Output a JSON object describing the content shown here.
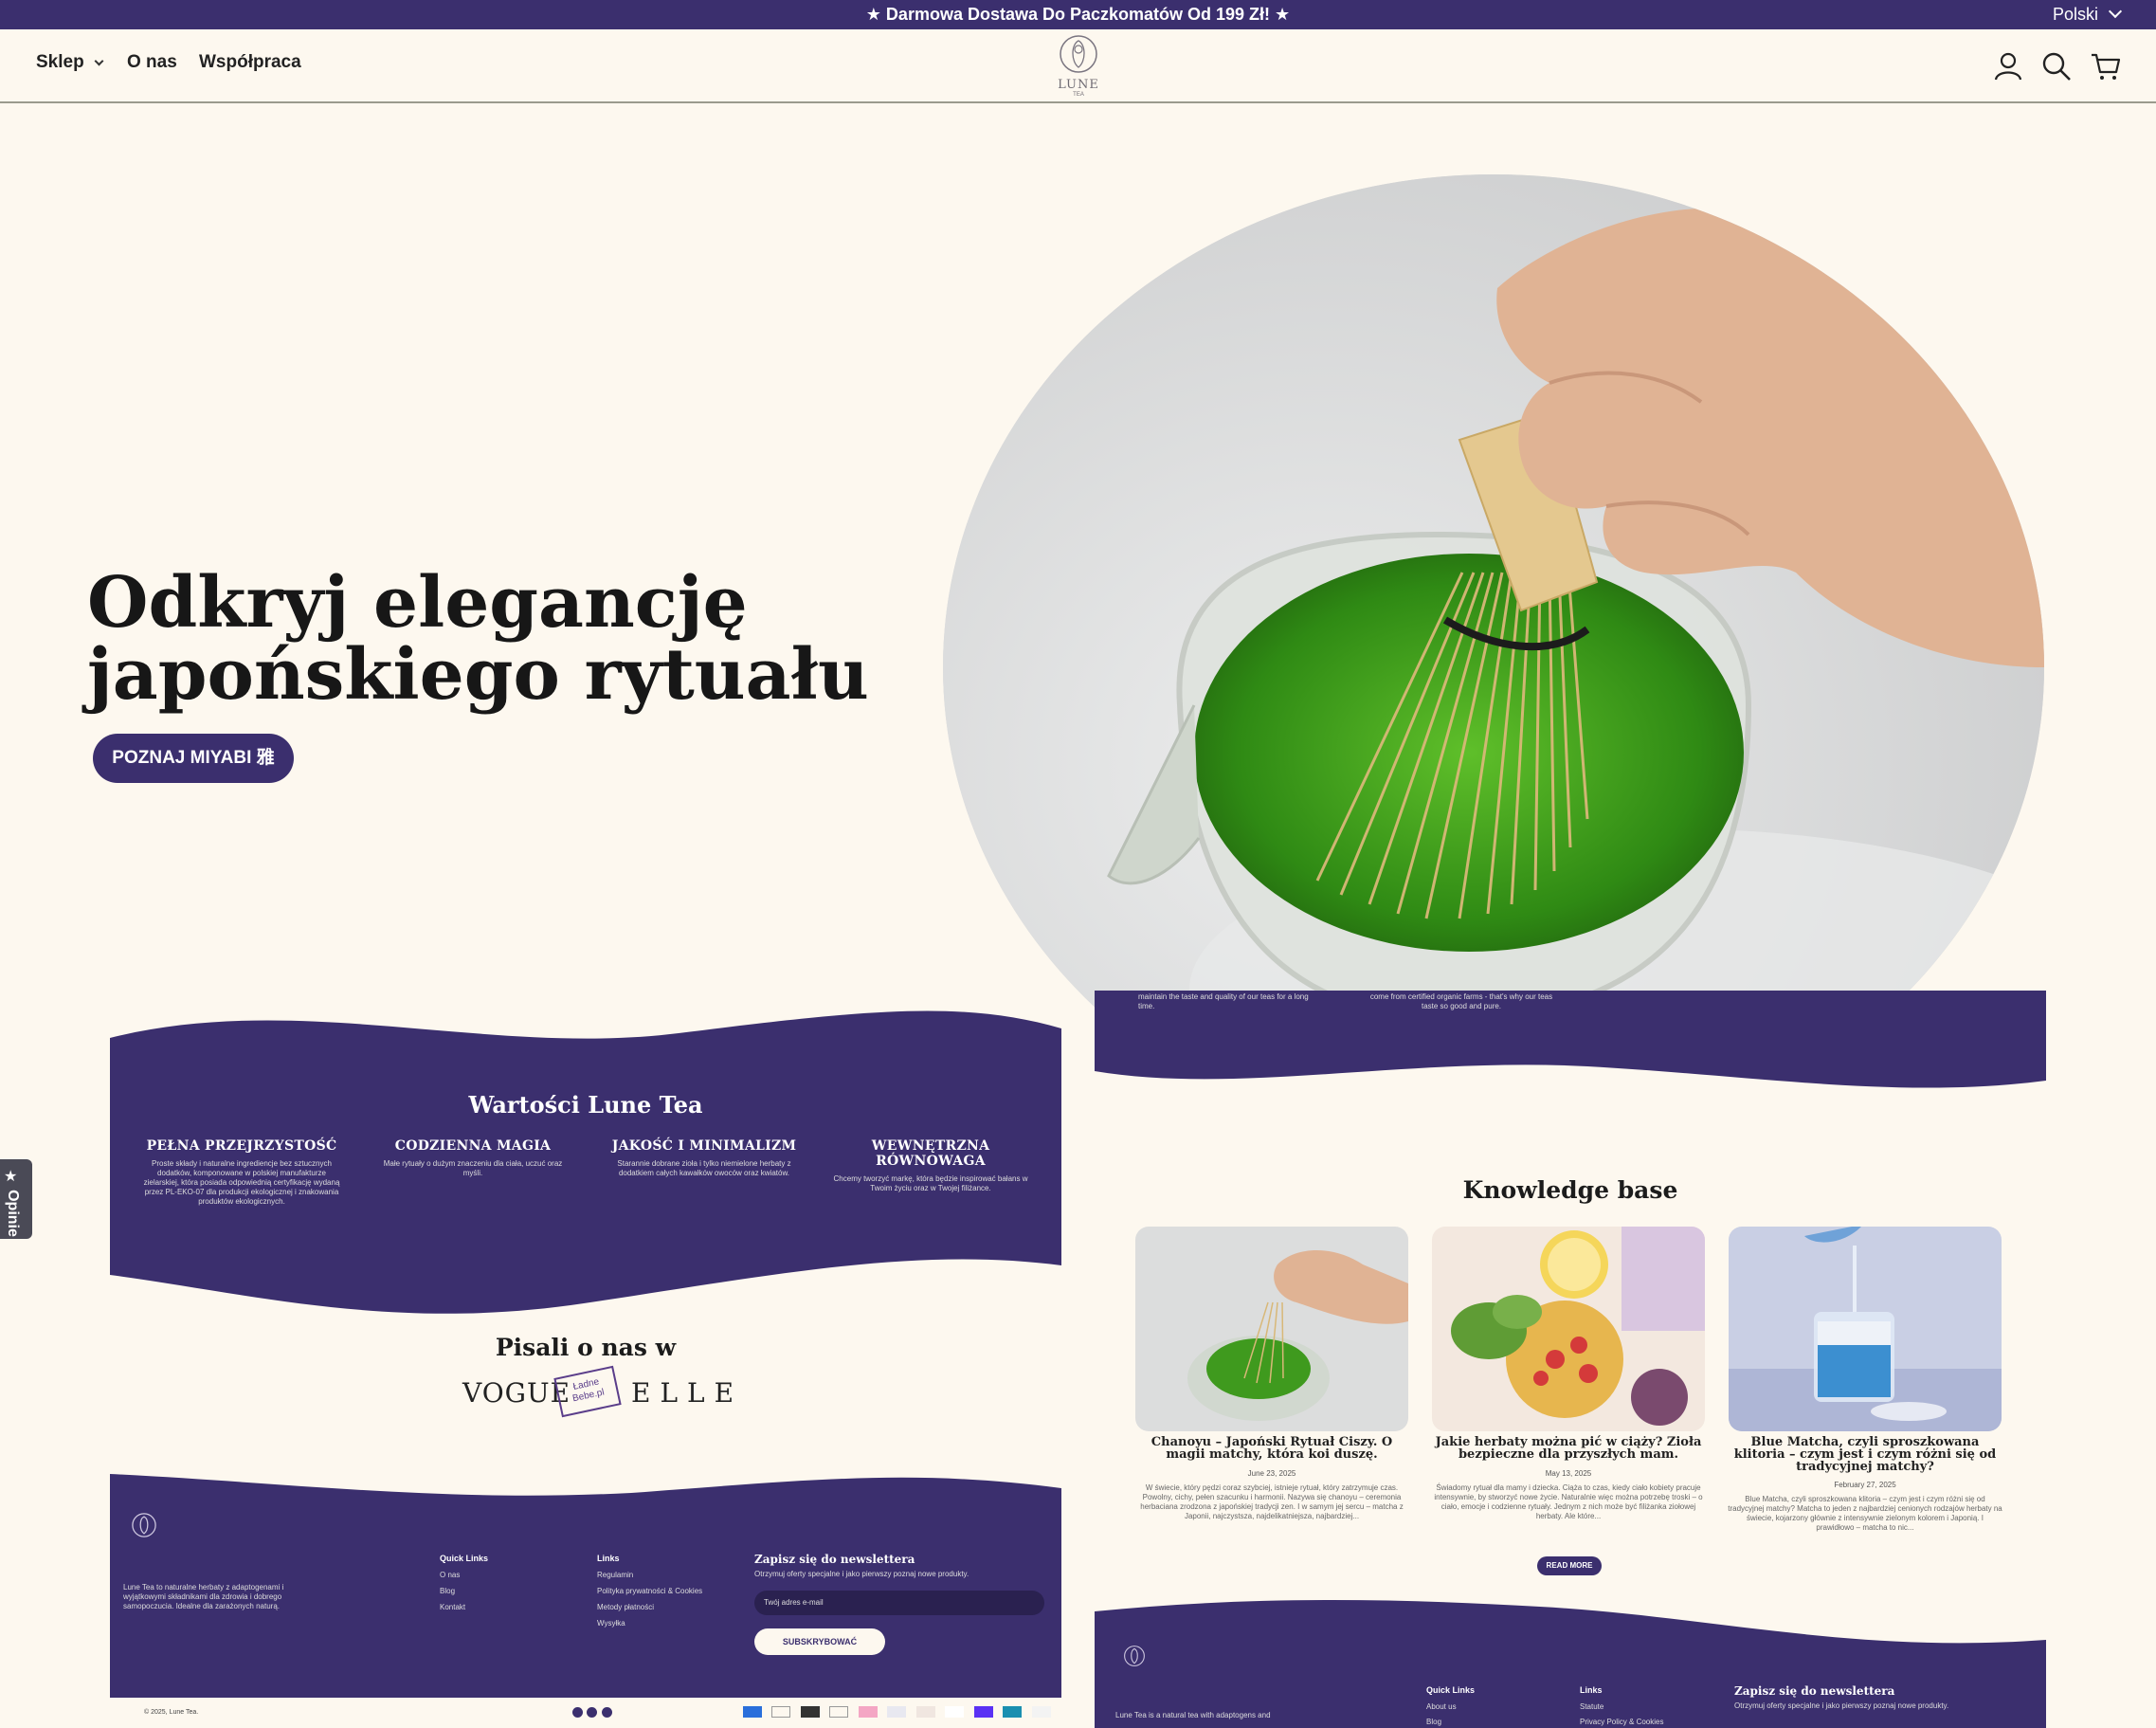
{
  "announcement": {
    "text": "★  Darmowa Dostawa Do Paczkomatów Od 199 Zł!  ★",
    "language": "Polski"
  },
  "nav": {
    "shop": "Sklep",
    "about": "O nas",
    "collab": "Współpraca"
  },
  "logo": {
    "name": "LUNE",
    "sub": "TEA"
  },
  "hero": {
    "title_line1": "Odkryj elegancję",
    "title_line2": "japońskiego rytuału",
    "cta": "POZNAJ MIYABI 雅"
  },
  "side_tab": {
    "label": "Opinie"
  },
  "values_section": {
    "title": "Wartości Lune Tea",
    "items": [
      {
        "title": "PEŁNA PRZEJRZYSTOŚĆ",
        "text": "Proste składy i naturalne ingrediencje bez sztucznych dodatków, komponowane w polskiej manufakturze zielarskiej, która posiada odpowiednią certyfikację wydaną przez PL-EKO-07 dla produkcji ekologicznej i znakowania produktów ekologicznych."
      },
      {
        "title": "CODZIENNA MAGIA",
        "text": "Małe rytuały o dużym znaczeniu dla ciała, uczuć oraz myśli."
      },
      {
        "title": "JAKOŚĆ I MINIMALIZM",
        "text": "Starannie dobrane zioła i tylko niemielone herbaty z dodatkiem całych kawałków owoców oraz kwiatów."
      },
      {
        "title": "WEWNĘTRZNA RÓWNOWAGA",
        "text": "Chcemy tworzyć markę, która będzie inspirować bałans w Twoim życiu oraz w Twojej filiżance."
      }
    ]
  },
  "press": {
    "title": "Pisali o nas w",
    "logos": [
      "VOGUE",
      "Ładne Bebe.pl",
      "ELLE"
    ]
  },
  "footer": {
    "about_text": "Lune Tea to naturalne herbaty z adaptogenami i wyjątkowymi składnikami dla zdrowia i dobrego samopoczucia. Idealne dla zarażonych naturą.",
    "quick_links_title": "Quick Links",
    "quick_links": [
      "O nas",
      "Blog",
      "Kontakt"
    ],
    "links_title": "Links",
    "links": [
      "Regulamin",
      "Polityka prywatności & Cookies",
      "Metody płatności",
      "Wysyłka"
    ],
    "newsletter_title": "Zapisz się do newslettera",
    "newsletter_text": "Otrzymuj oferty specjalne i jako pierwszy poznaj nowe produkty.",
    "email_placeholder": "Twój adres e-mail",
    "subscribe": "SUBSKRYBOWAĆ",
    "copyright": "© 2025, Lune Tea."
  },
  "right_preview": {
    "top_text_1": "maintain the taste and quality of our teas for a long time.",
    "top_text_2": "come from certified organic farms - that's why our teas taste so good and pure.",
    "kb_title": "Knowledge base",
    "articles": [
      {
        "title": "Chanoyu – Japoński Rytuał Ciszy. O magii matchy, która koi duszę.",
        "date": "June 23, 2025",
        "excerpt": "W świecie, który pędzi coraz szybciej, istnieje rytuał, który zatrzymuje czas. Powolny, cichy, pełen szacunku i harmonii. Nazywa się chanoyu – ceremonia herbaciana zrodzona z japońskiej tradycji zen. I w samym jej sercu – matcha z Japonii, najczystsza, najdelikatniejsza, najbardziej..."
      },
      {
        "title": "Jakie herbaty można pić w ciąży? Zioła bezpieczne dla przyszłych mam.",
        "date": "May 13, 2025",
        "excerpt": "Świadomy rytuał dla mamy i dziecka. Ciąża to czas, kiedy ciało kobiety pracuje intensywnie, by stworzyć nowe życie. Naturalnie więc można potrzebę troski – o ciało, emocje i codzienne rytuały. Jednym z nich może być filiżanka ziołowej herbaty. Ale które..."
      },
      {
        "title": "Blue Matcha, czyli sproszkowana klitoria – czym jest i czym różni się od tradycyjnej matchy?",
        "date": "February 27, 2025",
        "excerpt": "Blue Matcha, czyli sproszkowana klitoria – czym jest i czym różni się od tradycyjnej matchy? Matcha to jeden z najbardziej cenionych rodzajów herbaty na świecie, kojarzony głównie z intensywnie zielonym kolorem i Japonią. I prawidłowo – matcha to nic..."
      }
    ],
    "read_more": "READ MORE",
    "footer_about": "Lune Tea is a natural tea with adaptogens and",
    "footer_quick_title": "Quick Links",
    "footer_quick": [
      "About us",
      "Blog"
    ],
    "footer_links_title": "Links",
    "footer_links": [
      "Statute",
      "Privacy Policy & Cookies"
    ],
    "footer_news_title": "Zapisz się do newslettera",
    "footer_news_text": "Otrzymuj oferty specjalne i jako pierwszy poznaj nowe produkty."
  },
  "colors": {
    "purple": "#3b2f6e",
    "cream": "#fdf8ef"
  }
}
